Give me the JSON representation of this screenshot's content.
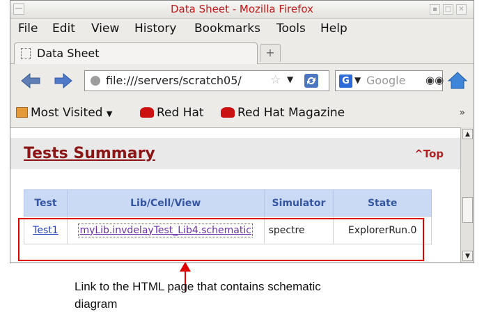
{
  "window": {
    "title": "Data Sheet - Mozilla Firefox"
  },
  "menu": [
    "File",
    "Edit",
    "View",
    "History",
    "Bookmarks",
    "Tools",
    "Help"
  ],
  "tab": {
    "label": "Data Sheet",
    "new_tab_symbol": "+"
  },
  "nav": {
    "url": "file:///servers/scratch05/",
    "search_engine": "G",
    "search_placeholder": "Google"
  },
  "bookmarks": [
    {
      "label": "Most Visited",
      "icon": "folder-icon"
    },
    {
      "label": "Red Hat",
      "icon": "redhat-icon"
    },
    {
      "label": "Red Hat Magazine",
      "icon": "redhat-icon"
    }
  ],
  "bookmarks_overflow": "»",
  "page": {
    "summary_title": "Tests Summary",
    "top_link": "^Top",
    "table": {
      "headers": [
        "Test",
        "Lib/Cell/View",
        "Simulator",
        "State"
      ],
      "rows": [
        [
          "Test1",
          "myLib.invdelayTest_Lib4.schematic",
          "spectre",
          "ExplorerRun.0"
        ]
      ]
    }
  },
  "annotation": {
    "text": "Link to the HTML page that contains schematic diagram"
  },
  "colors": {
    "title_red": "#c21a1a",
    "heading_red": "#8c1616",
    "table_header_bg": "#cad9f4",
    "annotation_red": "#e00000"
  }
}
